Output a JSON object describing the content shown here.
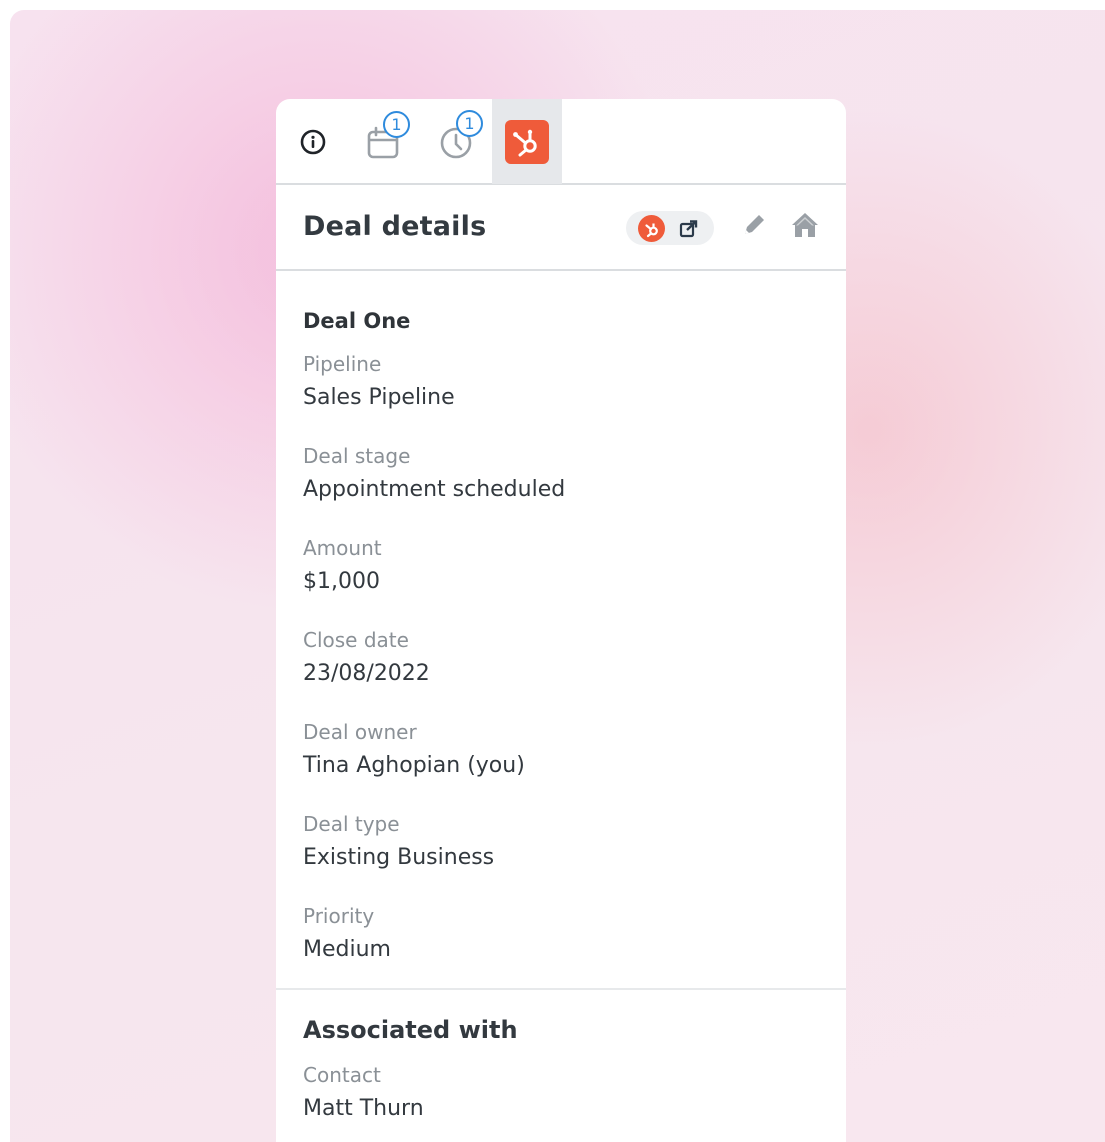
{
  "tabs": [
    {
      "name": "info",
      "icon": "info-icon"
    },
    {
      "name": "tasks",
      "icon": "calendar-icon",
      "badge": "1"
    },
    {
      "name": "activity",
      "icon": "clock-icon",
      "badge": "1"
    },
    {
      "name": "hubspot",
      "icon": "hubspot-icon",
      "active": true
    }
  ],
  "header": {
    "title": "Deal details",
    "actions": [
      "hubspot-icon",
      "external-link-icon",
      "pencil-icon",
      "home-icon"
    ]
  },
  "deal": {
    "name": "Deal One",
    "fields": [
      {
        "label": "Pipeline",
        "value": "Sales Pipeline"
      },
      {
        "label": "Deal stage",
        "value": "Appointment scheduled"
      },
      {
        "label": "Amount",
        "value": "$1,000"
      },
      {
        "label": "Close date",
        "value": "23/08/2022"
      },
      {
        "label": "Deal owner",
        "value": "Tina Aghopian (you)"
      },
      {
        "label": "Deal type",
        "value": "Existing Business"
      },
      {
        "label": "Priority",
        "value": "Medium"
      }
    ]
  },
  "associated": {
    "title": "Associated with",
    "fields": [
      {
        "label": "Contact",
        "value": "Matt Thurn"
      }
    ]
  },
  "colors": {
    "hubspot": "#ef5b3a",
    "badge": "#2f8bdd",
    "active_tab_bg": "#e6e8eb"
  }
}
